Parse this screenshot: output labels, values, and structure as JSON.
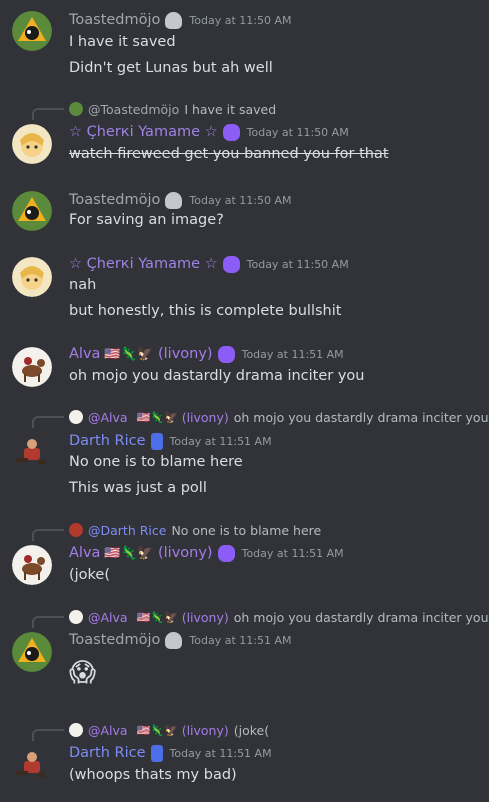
{
  "colors": {
    "background": "#313338",
    "toasted": "#a3a6aa",
    "cherki": "#9f83e6",
    "alva": "#a47de8",
    "darth": "#7d8ef3",
    "timestamp": "#949ba4",
    "text": "#dbdee1"
  },
  "messages": [
    {
      "author": "Toastedmöjo",
      "timestamp": "Today at 11:50 AM",
      "lines": [
        "I have it saved",
        "Didn't get Lunas but ah well"
      ]
    },
    {
      "reply": {
        "author": "@Toastedmöjo",
        "text": "I have it saved"
      },
      "author": "☆ Çherкi Yamame ☆",
      "timestamp": "Today at 11:50 AM",
      "lines": [
        "watch fireweed get you banned you for that"
      ]
    },
    {
      "author": "Toastedmöjo",
      "timestamp": "Today at 11:50 AM",
      "lines": [
        "For saving an image?"
      ]
    },
    {
      "author": "☆ Çherкi Yamame ☆",
      "timestamp": "Today at 11:50 AM",
      "lines": [
        "nah",
        "but honestly, this is complete bullshit"
      ]
    },
    {
      "author": "Alva",
      "author_suffix": "(livony)",
      "flags": "🇺🇸🦎🦅",
      "timestamp": "Today at 11:51 AM",
      "lines": [
        "oh mojo you dastardly drama inciter you"
      ]
    },
    {
      "reply": {
        "author": "@Alva",
        "flags": "🇺🇸🦎🦅",
        "suffix": "(livony)",
        "text": "oh mojo you dastardly drama inciter you"
      },
      "author": "Darth Rice",
      "timestamp": "Today at 11:51 AM",
      "lines": [
        "No one is to blame here",
        "This was just a poll"
      ]
    },
    {
      "reply": {
        "author": "@Darth Rice",
        "text": "No one is to blame here"
      },
      "author": "Alva",
      "author_suffix": "(livony)",
      "flags": "🇺🇸🦎🦅",
      "timestamp": "Today at 11:51 AM",
      "lines": [
        "(joke("
      ]
    },
    {
      "reply": {
        "author": "@Alva",
        "flags": "🇺🇸🦎🦅",
        "suffix": "(livony)",
        "text": "oh mojo you dastardly drama inciter you"
      },
      "author": "Toastedmöjo",
      "timestamp": "Today at 11:51 AM",
      "emoji": "😱",
      "lines": []
    },
    {
      "reply": {
        "author": "@Alva",
        "flags": "🇺🇸🦎🦅",
        "suffix": "(livony)",
        "text": "(joke("
      },
      "author": "Darth Rice",
      "timestamp": "Today at 11:51 AM",
      "lines": [
        "(whoops thats my bad)"
      ]
    }
  ]
}
